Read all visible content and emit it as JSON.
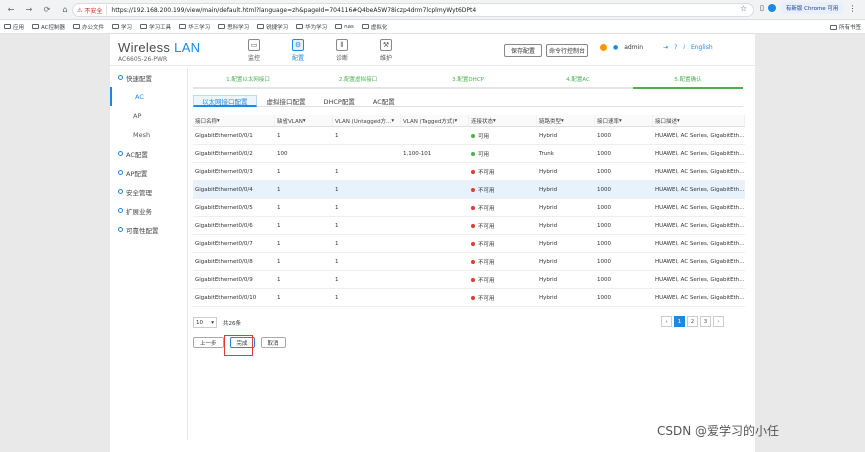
{
  "browser": {
    "security_label": "不安全",
    "url": "https://192.168.200.199/view/main/default.html?language=zh&pageId=704116#Q4beA5W78iczp4drm7lcplmyWyt6DPt4",
    "update_label": "有新版 Chrome 可用",
    "bookmarks": [
      "应用",
      "AC控制器",
      "办公文件",
      "学习",
      "学习工具",
      "华三学习",
      "思科学习",
      "锐捷学习",
      "华为学习",
      "nas",
      "虚拟化"
    ],
    "all_bookmarks": "所有书签"
  },
  "header": {
    "brand_main": "Wireless",
    "brand_accent": "LAN",
    "model": "AC6605-26-PWR",
    "nav": [
      {
        "label": "监控",
        "icon": "monitor-icon"
      },
      {
        "label": "配置",
        "icon": "gear-icon"
      },
      {
        "label": "诊断",
        "icon": "diagnose-icon"
      },
      {
        "label": "维护",
        "icon": "maintain-icon"
      }
    ],
    "save_config": "保存配置",
    "cli": "命令行控制台",
    "user": "admin",
    "lang": "English"
  },
  "sidebar": {
    "items": [
      {
        "label": "快速配置",
        "type": "group"
      },
      {
        "label": "AC",
        "type": "sub",
        "active": true
      },
      {
        "label": "AP",
        "type": "sub"
      },
      {
        "label": "Mesh",
        "type": "sub"
      },
      {
        "label": "AC配置",
        "type": "group"
      },
      {
        "label": "AP配置",
        "type": "group"
      },
      {
        "label": "安全管理",
        "type": "group"
      },
      {
        "label": "扩展业务",
        "type": "group"
      },
      {
        "label": "可靠性配置",
        "type": "group"
      }
    ]
  },
  "steps": [
    "1.配置以太网接口",
    "2.配置虚拟接口",
    "3.配置DHCP",
    "4.配置AC",
    "5.配置确认"
  ],
  "tabs": [
    "以太网接口配置",
    "虚拟接口配置",
    "DHCP配置",
    "AC配置"
  ],
  "table": {
    "headers": [
      "接口名称",
      "缺省VLAN",
      "VLAN (Untagged方...",
      "VLAN (Tagged方式)",
      "连接状态",
      "链路类型",
      "接口速率",
      "接口描述"
    ],
    "rows": [
      {
        "name": "GigabitEthernet0/0/1",
        "pvid": "1",
        "untagged": "1",
        "tagged": "",
        "status": "可用",
        "up": true,
        "link": "Hybrid",
        "speed": "1000",
        "desc": "HUAWEI, AC Series, GigabitEth..."
      },
      {
        "name": "GigabitEthernet0/0/2",
        "pvid": "100",
        "untagged": "",
        "tagged": "1,100-101",
        "status": "可用",
        "up": true,
        "link": "Trunk",
        "speed": "1000",
        "desc": "HUAWEI, AC Series, GigabitEth..."
      },
      {
        "name": "GigabitEthernet0/0/3",
        "pvid": "1",
        "untagged": "1",
        "tagged": "",
        "status": "不可用",
        "up": false,
        "link": "Hybrid",
        "speed": "1000",
        "desc": "HUAWEI, AC Series, GigabitEth..."
      },
      {
        "name": "GigabitEthernet0/0/4",
        "pvid": "1",
        "untagged": "1",
        "tagged": "",
        "status": "不可用",
        "up": false,
        "link": "Hybrid",
        "speed": "1000",
        "desc": "HUAWEI, AC Series, GigabitEth...",
        "selected": true
      },
      {
        "name": "GigabitEthernet0/0/5",
        "pvid": "1",
        "untagged": "1",
        "tagged": "",
        "status": "不可用",
        "up": false,
        "link": "Hybrid",
        "speed": "1000",
        "desc": "HUAWEI, AC Series, GigabitEth..."
      },
      {
        "name": "GigabitEthernet0/0/6",
        "pvid": "1",
        "untagged": "1",
        "tagged": "",
        "status": "不可用",
        "up": false,
        "link": "Hybrid",
        "speed": "1000",
        "desc": "HUAWEI, AC Series, GigabitEth..."
      },
      {
        "name": "GigabitEthernet0/0/7",
        "pvid": "1",
        "untagged": "1",
        "tagged": "",
        "status": "不可用",
        "up": false,
        "link": "Hybrid",
        "speed": "1000",
        "desc": "HUAWEI, AC Series, GigabitEth..."
      },
      {
        "name": "GigabitEthernet0/0/8",
        "pvid": "1",
        "untagged": "1",
        "tagged": "",
        "status": "不可用",
        "up": false,
        "link": "Hybrid",
        "speed": "1000",
        "desc": "HUAWEI, AC Series, GigabitEth..."
      },
      {
        "name": "GigabitEthernet0/0/9",
        "pvid": "1",
        "untagged": "1",
        "tagged": "",
        "status": "不可用",
        "up": false,
        "link": "Hybrid",
        "speed": "1000",
        "desc": "HUAWEI, AC Series, GigabitEth..."
      },
      {
        "name": "GigabitEthernet0/0/10",
        "pvid": "1",
        "untagged": "1",
        "tagged": "",
        "status": "不可用",
        "up": false,
        "link": "Hybrid",
        "speed": "1000",
        "desc": "HUAWEI, AC Series, GigabitEth..."
      }
    ]
  },
  "pager": {
    "size": "10",
    "total": "共26条",
    "pages": [
      "1",
      "2",
      "3"
    ]
  },
  "actions": {
    "prev": "上一步",
    "finish": "完成",
    "cancel": "取消"
  },
  "colors": {
    "accent": "#1e88e5",
    "ok": "#4caf50",
    "bad": "#e53935"
  },
  "watermark": "CSDN @爱学习的小任"
}
